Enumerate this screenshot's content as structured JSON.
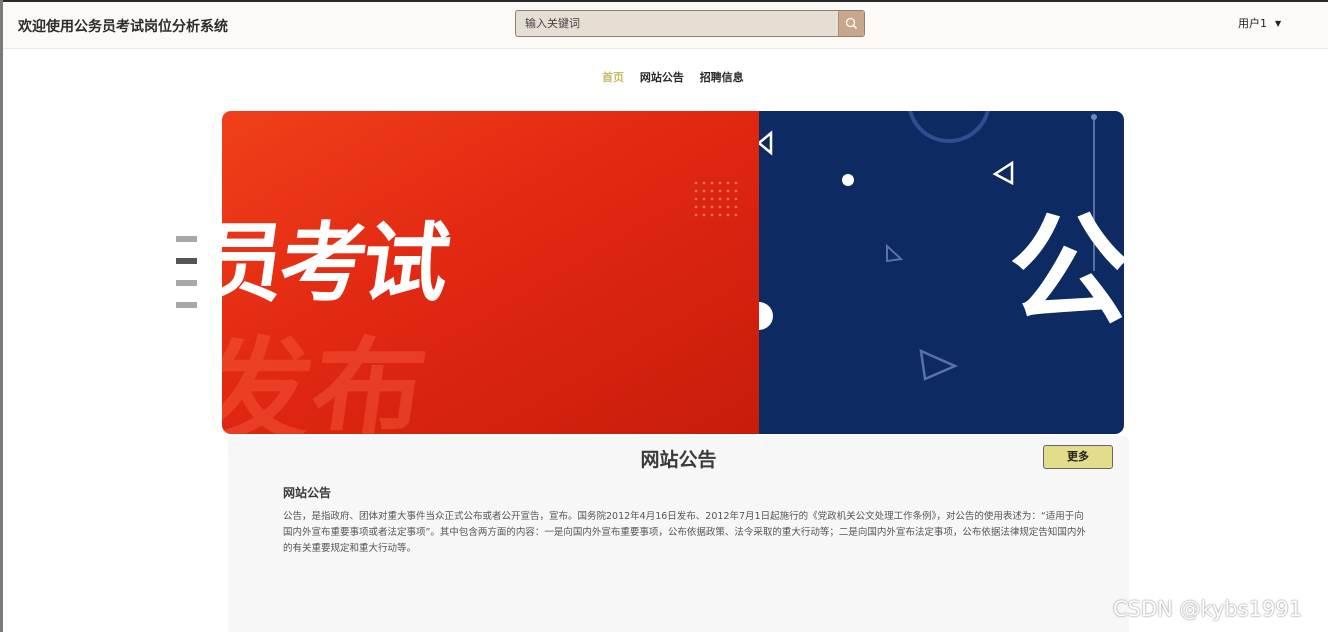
{
  "header": {
    "title": "欢迎使用公务员考试岗位分析系统",
    "search_placeholder": "输入关键词",
    "user": "用户1"
  },
  "nav": [
    "首页",
    "网站公告",
    "招聘信息"
  ],
  "banner": {
    "main_text": "员考试",
    "ghost_text": "发布",
    "right_text": "公"
  },
  "notice": {
    "section_title": "网站公告",
    "more_label": "更多",
    "item_title": "网站公告",
    "item_body": "公告，是指政府、团体对重大事件当众正式公布或者公开宣告，宣布。国务院2012年4月16日发布、2012年7月1日起施行的《党政机关公文处理工作条例》，对公告的使用表述为：“适用于向国内外宣布重要事项或者法定事项”。其中包含两方面的内容：一是向国内外宣布重要事项，公布依据政策、法令采取的重大行动等；二是向国内外宣布法定事项，公布依据法律规定告知国内外的有关重要规定和重大行动等。"
  },
  "watermark": "CSDN @kybs1991"
}
